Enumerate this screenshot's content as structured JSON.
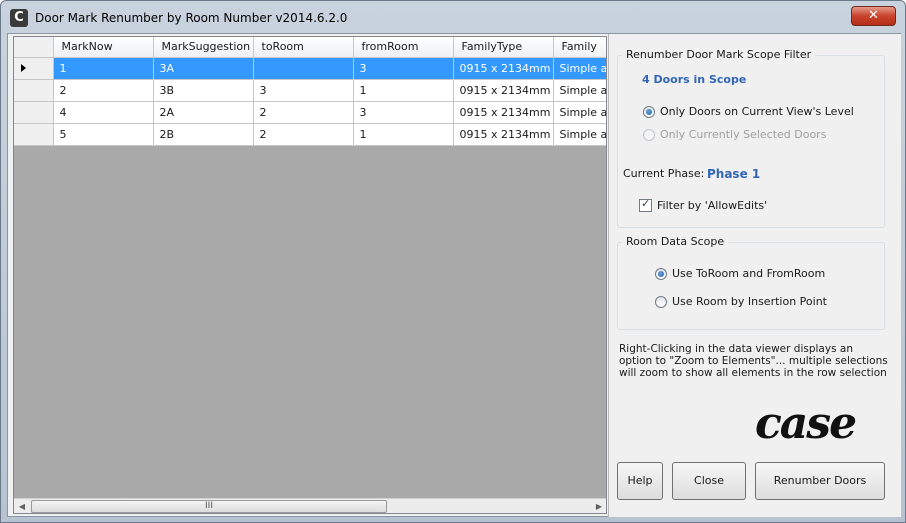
{
  "window": {
    "title": "Door Mark Renumber by Room Number v2014.6.2.0",
    "app_icon_letter": "C",
    "close_glyph": "✕"
  },
  "grid": {
    "columns": [
      "MarkNow",
      "MarkSuggestion",
      "toRoom",
      "fromRoom",
      "FamilyType",
      "Family"
    ],
    "rows": [
      {
        "cells": [
          "1",
          "3A",
          "",
          "3",
          "0915 x 2134mm",
          "Simple ave"
        ],
        "selected": true
      },
      {
        "cells": [
          "2",
          "3B",
          "3",
          "1",
          "0915 x 2134mm",
          "Simple ave"
        ],
        "selected": false
      },
      {
        "cells": [
          "4",
          "2A",
          "2",
          "3",
          "0915 x 2134mm",
          "Simple ave"
        ],
        "selected": false
      },
      {
        "cells": [
          "5",
          "2B",
          "2",
          "1",
          "0915 x 2134mm",
          "Simple ave"
        ],
        "selected": false
      }
    ],
    "scroll_thumb_grip": "III"
  },
  "scope_filter": {
    "title": "Renumber Door Mark Scope Filter",
    "count_label": "4 Doors in Scope",
    "option_current_level": "Only Doors on Current View's Level",
    "option_selected": "Only Currently Selected Doors",
    "phase_label": "Current Phase:",
    "phase_value": "Phase 1",
    "filter_allow_edits": "Filter by 'AllowEdits'"
  },
  "room_scope": {
    "title": "Room Data Scope",
    "option_to_from": "Use ToRoom and FromRoom",
    "option_insertion": "Use Room by Insertion Point"
  },
  "info_text": "Right-Clicking in the data viewer displays an option to \"Zoom to Elements\"... multiple selections will zoom to show all elements in the row selection",
  "logo_text": "case",
  "buttons": {
    "help": "Help",
    "close": "Close",
    "renumber": "Renumber Doors"
  },
  "colors": {
    "selection": "#3399ff",
    "accent_text": "#3367b4",
    "grid_background": "#a9a9a9"
  }
}
